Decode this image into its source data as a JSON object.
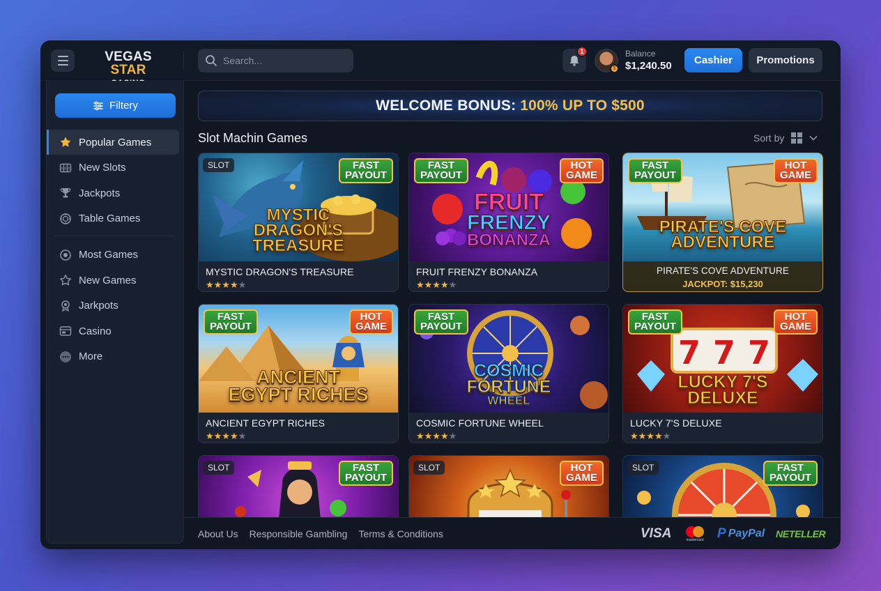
{
  "header": {
    "logo_line1_a": "VEGAS",
    "logo_line1_b": "STAR",
    "logo_line2": "CASINO",
    "search_placeholder": "Search...",
    "notification_count": "1",
    "balance_label": "Balance",
    "balance_value": "$1,240.50",
    "cashier_label": "Cashier",
    "promotions_label": "Promotions"
  },
  "sidebar": {
    "filter_label": "Filtery",
    "primary_items": [
      {
        "label": "Popular Games",
        "icon": "star-icon",
        "active": true
      },
      {
        "label": "New Slots",
        "icon": "slot-icon"
      },
      {
        "label": "Jackpots",
        "icon": "trophy-icon"
      },
      {
        "label": "Table Games",
        "icon": "chip-icon"
      }
    ],
    "secondary_items": [
      {
        "label": "Most Games",
        "icon": "badge-icon"
      },
      {
        "label": "New Games",
        "icon": "star-outline-icon"
      },
      {
        "label": "Jarkpots",
        "icon": "trophy-icon"
      },
      {
        "label": "Casino",
        "icon": "cards-icon"
      },
      {
        "label": "More",
        "icon": "more-icon"
      }
    ]
  },
  "banner": {
    "part1": "WELCOME BONUS:",
    "part2": "100% UP TO $500"
  },
  "section": {
    "title": "Slot Machin Games",
    "sort_label": "Sort by"
  },
  "tags": {
    "fast_l1": "FAST",
    "fast_l2": "PAYOUT",
    "hot_l1": "HOT",
    "hot_l2": "GAME",
    "slot": "SLOT"
  },
  "games": [
    {
      "name": "MYSTIC DRAGON'S TREASURE",
      "art": [
        "MYSTIC",
        "DRAGON'S",
        "TREASURE"
      ],
      "rating": 4,
      "max": 5
    },
    {
      "name": "FRUIT FRENZY BONANZA",
      "art": [
        "FRUIT",
        "FRENZY",
        "BONANZA"
      ],
      "rating": 4,
      "max": 5
    },
    {
      "name": "PIRATE'S COVE ADVENTURE",
      "art": [
        "PIRATE'S COVE",
        "ADVENTURE"
      ],
      "jackpot": "JACKPOT: $15,230"
    },
    {
      "name": "ANCIENT EGYPT RICHES",
      "art": [
        "ANCIENT",
        "EGYPT RICHES"
      ],
      "rating": 4,
      "max": 5
    },
    {
      "name": "COSMIC FORTUNE WHEEL",
      "art": [
        "COSMIC",
        "FORTUNE",
        "WHEEL"
      ],
      "rating": 4,
      "max": 5
    },
    {
      "name": "LUCKY 7'S DELUXE",
      "art": [
        "LUCKY 7'S",
        "DELUXE"
      ],
      "rating": 4,
      "max": 5
    },
    {
      "name": "",
      "art": []
    },
    {
      "name": "",
      "art": []
    },
    {
      "name": "",
      "art": []
    }
  ],
  "footer": {
    "links": [
      "About Us",
      "Responsible Gambling",
      "Terms & Conditions"
    ],
    "payments": [
      "VISA",
      "mastercard",
      "PayPal",
      "NETELLER"
    ]
  },
  "colors": {
    "accent_blue": "#2b86ef",
    "gold": "#f2c04a",
    "fast_green": "#2e9a36",
    "hot_orange": "#e8532a"
  }
}
